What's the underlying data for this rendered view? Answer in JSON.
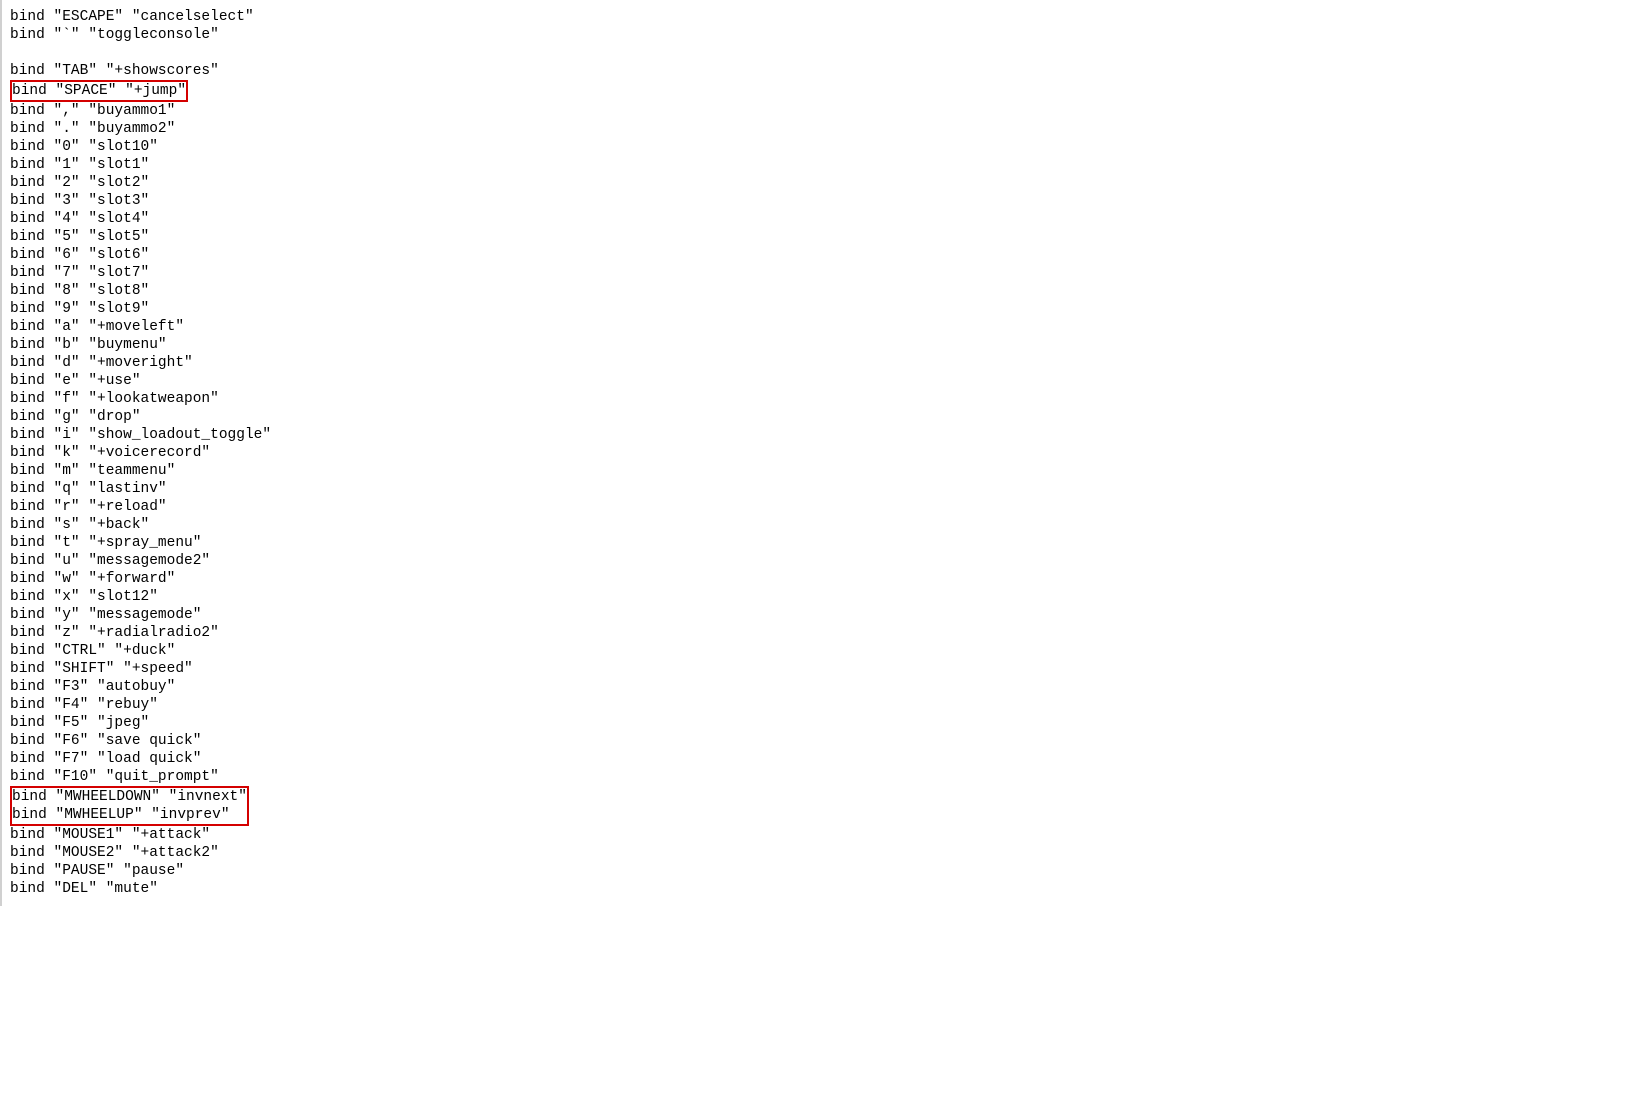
{
  "lines": [
    {
      "text": "bind \"ESCAPE\" \"cancelselect\"",
      "hl": 0
    },
    {
      "text": "bind \"`\" \"toggleconsole\"",
      "hl": 0
    },
    {
      "text": "",
      "hl": 0
    },
    {
      "text": "bind \"TAB\" \"+showscores\"",
      "hl": 0
    },
    {
      "text": "bind \"SPACE\" \"+jump\"",
      "hl": 1
    },
    {
      "text": "bind \",\" \"buyammo1\"",
      "hl": 0
    },
    {
      "text": "bind \".\" \"buyammo2\"",
      "hl": 0
    },
    {
      "text": "bind \"0\" \"slot10\"",
      "hl": 0
    },
    {
      "text": "bind \"1\" \"slot1\"",
      "hl": 0
    },
    {
      "text": "bind \"2\" \"slot2\"",
      "hl": 0
    },
    {
      "text": "bind \"3\" \"slot3\"",
      "hl": 0
    },
    {
      "text": "bind \"4\" \"slot4\"",
      "hl": 0
    },
    {
      "text": "bind \"5\" \"slot5\"",
      "hl": 0
    },
    {
      "text": "bind \"6\" \"slot6\"",
      "hl": 0
    },
    {
      "text": "bind \"7\" \"slot7\"",
      "hl": 0
    },
    {
      "text": "bind \"8\" \"slot8\"",
      "hl": 0
    },
    {
      "text": "bind \"9\" \"slot9\"",
      "hl": 0
    },
    {
      "text": "bind \"a\" \"+moveleft\"",
      "hl": 0
    },
    {
      "text": "bind \"b\" \"buymenu\"",
      "hl": 0
    },
    {
      "text": "bind \"d\" \"+moveright\"",
      "hl": 0
    },
    {
      "text": "bind \"e\" \"+use\"",
      "hl": 0
    },
    {
      "text": "bind \"f\" \"+lookatweapon\"",
      "hl": 0
    },
    {
      "text": "bind \"g\" \"drop\"",
      "hl": 0
    },
    {
      "text": "bind \"i\" \"show_loadout_toggle\"",
      "hl": 0
    },
    {
      "text": "bind \"k\" \"+voicerecord\"",
      "hl": 0
    },
    {
      "text": "bind \"m\" \"teammenu\"",
      "hl": 0
    },
    {
      "text": "bind \"q\" \"lastinv\"",
      "hl": 0
    },
    {
      "text": "bind \"r\" \"+reload\"",
      "hl": 0
    },
    {
      "text": "bind \"s\" \"+back\"",
      "hl": 0
    },
    {
      "text": "bind \"t\" \"+spray_menu\"",
      "hl": 0
    },
    {
      "text": "bind \"u\" \"messagemode2\"",
      "hl": 0
    },
    {
      "text": "bind \"w\" \"+forward\"",
      "hl": 0
    },
    {
      "text": "bind \"x\" \"slot12\"",
      "hl": 0
    },
    {
      "text": "bind \"y\" \"messagemode\"",
      "hl": 0
    },
    {
      "text": "bind \"z\" \"+radialradio2\"",
      "hl": 0
    },
    {
      "text": "bind \"CTRL\" \"+duck\"",
      "hl": 0
    },
    {
      "text": "bind \"SHIFT\" \"+speed\"",
      "hl": 0
    },
    {
      "text": "bind \"F3\" \"autobuy\"",
      "hl": 0
    },
    {
      "text": "bind \"F4\" \"rebuy\"",
      "hl": 0
    },
    {
      "text": "bind \"F5\" \"jpeg\"",
      "hl": 0
    },
    {
      "text": "bind \"F6\" \"save quick\"",
      "hl": 0
    },
    {
      "text": "bind \"F7\" \"load quick\"",
      "hl": 0
    },
    {
      "text": "bind \"F10\" \"quit_prompt\"",
      "hl": 0
    },
    {
      "text": "bind \"MWHEELDOWN\" \"invnext\"",
      "hl": 2
    },
    {
      "text": "bind \"MWHEELUP\" \"invprev\"",
      "hl": 2
    },
    {
      "text": "bind \"MOUSE1\" \"+attack\"",
      "hl": 0
    },
    {
      "text": "bind \"MOUSE2\" \"+attack2\"",
      "hl": 0
    },
    {
      "text": "bind \"PAUSE\" \"pause\"",
      "hl": 0
    },
    {
      "text": "bind \"DEL\" \"mute\"",
      "hl": 0
    }
  ]
}
